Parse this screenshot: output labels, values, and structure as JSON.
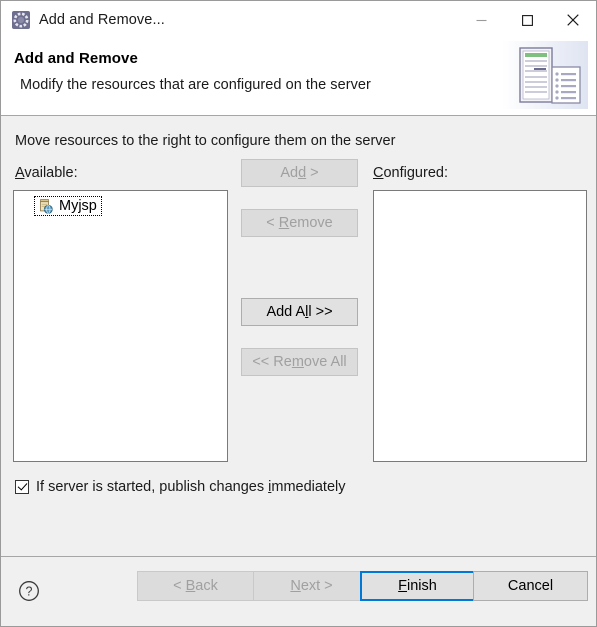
{
  "window": {
    "title": "Add and Remove...",
    "icon": "eclipse-wizard-icon",
    "controls": {
      "minimize": "minimize-icon",
      "maximize": "maximize-icon",
      "close": "close-icon"
    }
  },
  "header": {
    "title": "Add and Remove",
    "description": "Modify the resources that are configured on the server",
    "banner_icon": "server-and-document-icon"
  },
  "body": {
    "instruction": "Move resources to the right to configure them on the server",
    "available": {
      "label_pre": "A",
      "label_mnemonic": "",
      "label": "Available:",
      "label_head": "A",
      "label_tail": "vailable:",
      "items": [
        {
          "label": "Myjsp",
          "icon": "web-module-icon",
          "selected": true
        }
      ]
    },
    "configured": {
      "label_head": "C",
      "label_tail": "onfigured:",
      "items": []
    },
    "transfer_buttons": [
      {
        "name": "add-button",
        "label": "Add >",
        "enabled": false
      },
      {
        "name": "remove-button",
        "label": "< Remove",
        "enabled": false
      },
      {
        "name": "add-all-button",
        "label": "Add All >>",
        "enabled": true
      },
      {
        "name": "remove-all-button",
        "label": "<< Remove All",
        "enabled": false
      }
    ],
    "publish_checkbox": {
      "label": "If server is started, publish changes immediately",
      "checked": true
    }
  },
  "footer": {
    "help_label": "?",
    "buttons": [
      {
        "name": "back-button",
        "label": "< Back",
        "enabled": false,
        "default": false
      },
      {
        "name": "next-button",
        "label": "Next >",
        "enabled": false,
        "default": false
      },
      {
        "name": "finish-button",
        "label": "Finish",
        "enabled": true,
        "default": true
      },
      {
        "name": "cancel-button",
        "label": "Cancel",
        "enabled": true,
        "default": false
      }
    ]
  },
  "colors": {
    "accent": "#0078d7",
    "dialog_bg": "#f0f0f0",
    "header_bg": "#ffffff",
    "button_bg": "#e1e1e1",
    "disabled_text": "#a0a0a0"
  }
}
